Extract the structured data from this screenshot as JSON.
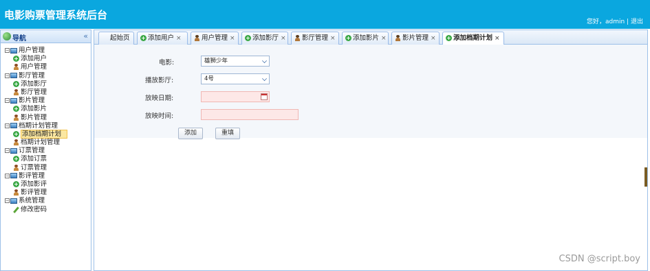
{
  "header": {
    "title": "电影购票管理系统后台",
    "greeting": "您好，admin",
    "separator": "|",
    "logout": "退出"
  },
  "nav": {
    "title": "导航",
    "collapse": "«",
    "groups": [
      {
        "label": "用户管理",
        "children": [
          {
            "label": "添加用户",
            "icon": "plus-icon"
          },
          {
            "label": "用户管理",
            "icon": "user-icon"
          }
        ]
      },
      {
        "label": "影厅管理",
        "children": [
          {
            "label": "添加影厅",
            "icon": "plus-icon"
          },
          {
            "label": "影厅管理",
            "icon": "user-icon"
          }
        ]
      },
      {
        "label": "影片管理",
        "children": [
          {
            "label": "添加影片",
            "icon": "plus-icon"
          },
          {
            "label": "影片管理",
            "icon": "user-icon"
          }
        ]
      },
      {
        "label": "档期计划管理",
        "children": [
          {
            "label": "添加档期计划",
            "icon": "plus-icon",
            "selected": true
          },
          {
            "label": "档期计划管理",
            "icon": "user-icon"
          }
        ]
      },
      {
        "label": "订票管理",
        "children": [
          {
            "label": "添加订票",
            "icon": "plus-icon"
          },
          {
            "label": "订票管理",
            "icon": "user-icon"
          }
        ]
      },
      {
        "label": "影评管理",
        "children": [
          {
            "label": "添加影评",
            "icon": "plus-icon"
          },
          {
            "label": "影评管理",
            "icon": "user-icon"
          }
        ]
      },
      {
        "label": "系统管理",
        "children": [
          {
            "label": "修改密码",
            "icon": "pencil-icon"
          }
        ]
      }
    ]
  },
  "tabs": [
    {
      "label": "起始页",
      "icon": "",
      "closable": false
    },
    {
      "label": "添加用户",
      "icon": "plus-icon",
      "closable": true
    },
    {
      "label": "用户管理",
      "icon": "user-icon",
      "closable": true
    },
    {
      "label": "添加影厅",
      "icon": "plus-icon",
      "closable": true
    },
    {
      "label": "影厅管理",
      "icon": "user-icon",
      "closable": true
    },
    {
      "label": "添加影片",
      "icon": "plus-icon",
      "closable": true
    },
    {
      "label": "影片管理",
      "icon": "user-icon",
      "closable": true
    },
    {
      "label": "添加档期计划",
      "icon": "plus-icon",
      "closable": true,
      "active": true
    }
  ],
  "form": {
    "movie_label": "电影:",
    "movie_value": "雄狮少年",
    "hall_label": "播放影厅:",
    "hall_value": "4号",
    "date_label": "放映日期:",
    "date_value": "",
    "time_label": "放映时间:",
    "time_value": "",
    "add_button": "添加",
    "reset_button": "重填"
  },
  "watermark": "CSDN @script.boy",
  "colors": {
    "header": "#0aa7df",
    "border": "#9cc0e8",
    "invalid_field": "#fde8e7"
  }
}
